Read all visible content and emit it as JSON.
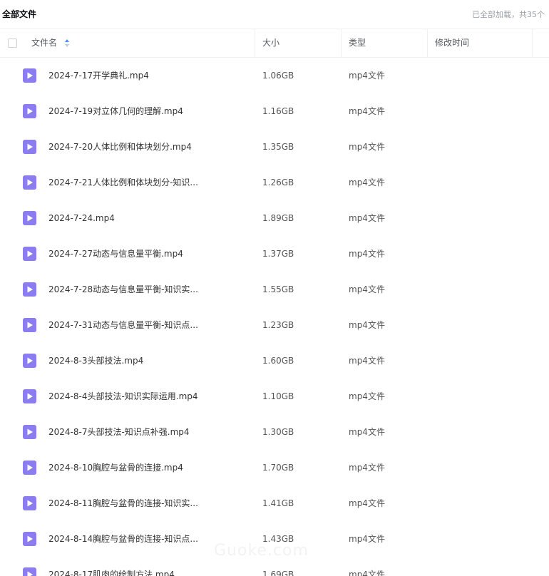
{
  "header": {
    "breadcrumb": "全部文件",
    "status": "已全部加载，共35个"
  },
  "columns": {
    "name": "文件名",
    "size": "大小",
    "type": "类型",
    "modified": "修改时间"
  },
  "colors": {
    "icon": "#8b7cf0",
    "border": "#eef0f4",
    "muted": "#9aa0a8",
    "sort": "#4a8ff7"
  },
  "rows": [
    {
      "name": "2024-7-17开学典礼.mp4",
      "size": "1.06GB",
      "type": "mp4文件"
    },
    {
      "name": "2024-7-19对立体几何的理解.mp4",
      "size": "1.16GB",
      "type": "mp4文件"
    },
    {
      "name": "2024-7-20人体比例和体块划分.mp4",
      "size": "1.35GB",
      "type": "mp4文件"
    },
    {
      "name": "2024-7-21人体比例和体块划分-知识...",
      "size": "1.26GB",
      "type": "mp4文件"
    },
    {
      "name": "2024-7-24.mp4",
      "size": "1.89GB",
      "type": "mp4文件"
    },
    {
      "name": "2024-7-27动态与信息量平衡.mp4",
      "size": "1.37GB",
      "type": "mp4文件"
    },
    {
      "name": "2024-7-28动态与信息量平衡-知识实...",
      "size": "1.55GB",
      "type": "mp4文件"
    },
    {
      "name": "2024-7-31动态与信息量平衡-知识点...",
      "size": "1.23GB",
      "type": "mp4文件"
    },
    {
      "name": "2024-8-3头部技法.mp4",
      "size": "1.60GB",
      "type": "mp4文件"
    },
    {
      "name": "2024-8-4头部技法-知识实际运用.mp4",
      "size": "1.10GB",
      "type": "mp4文件"
    },
    {
      "name": "2024-8-7头部技法-知识点补强.mp4",
      "size": "1.30GB",
      "type": "mp4文件"
    },
    {
      "name": "2024-8-10胸腔与盆骨的连接.mp4",
      "size": "1.70GB",
      "type": "mp4文件"
    },
    {
      "name": "2024-8-11胸腔与盆骨的连接-知识实...",
      "size": "1.41GB",
      "type": "mp4文件"
    },
    {
      "name": "2024-8-14胸腔与盆骨的连接-知识点...",
      "size": "1.43GB",
      "type": "mp4文件"
    },
    {
      "name": "2024-8-17肌肉的绘制方法.mp4",
      "size": "1.69GB",
      "type": "mp4文件"
    }
  ]
}
